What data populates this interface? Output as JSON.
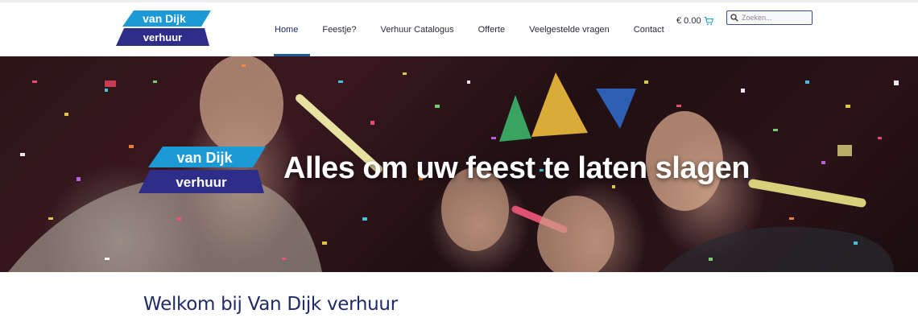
{
  "brand": {
    "logo_line1": "van Dijk",
    "logo_line2": "verhuur",
    "colors": {
      "light_blue": "#1c9ad6",
      "dark_navy": "#2e2e8a"
    }
  },
  "nav": {
    "items": [
      {
        "label": "Home",
        "active": true
      },
      {
        "label": "Feestje?"
      },
      {
        "label": "Verhuur Catalogus"
      },
      {
        "label": "Offerte"
      },
      {
        "label": "Veelgestelde vragen"
      },
      {
        "label": "Contact"
      }
    ]
  },
  "cart": {
    "amount": "€ 0.00",
    "icon": "cart-icon"
  },
  "search": {
    "placeholder": "Zoeken...",
    "icon": "search-icon"
  },
  "hero": {
    "title": "Alles om uw feest te laten slagen"
  },
  "main": {
    "heading": "Welkom bij Van Dijk verhuur"
  }
}
